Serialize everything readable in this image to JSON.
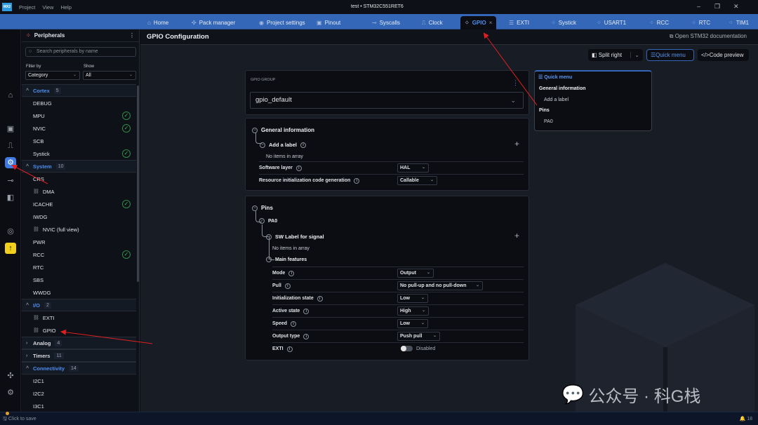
{
  "titlebar": {
    "logo": "MX2",
    "menus": [
      "Project",
      "View",
      "Help"
    ],
    "title": "test  •  STM32C551RET6"
  },
  "tabs": [
    {
      "label": "Home",
      "icon": "home-icon"
    },
    {
      "label": "Pack manager",
      "icon": "puzzle-icon"
    },
    {
      "label": "Project settings",
      "icon": "settings-icon"
    },
    {
      "label": "Pinout",
      "icon": "chip-icon"
    },
    {
      "label": "Syscalls",
      "icon": "syscalls-icon"
    },
    {
      "label": "Clock",
      "icon": "clock-signal-icon"
    },
    {
      "label": "GPIO",
      "icon": "peripheral-icon",
      "active": true
    },
    {
      "label": "EXTI",
      "icon": "sliders-icon"
    },
    {
      "label": "Systick",
      "icon": "peripheral-icon"
    },
    {
      "label": "USART1",
      "icon": "peripheral-icon"
    },
    {
      "label": "RCC",
      "icon": "peripheral-icon"
    },
    {
      "label": "RTC",
      "icon": "peripheral-icon"
    },
    {
      "label": "TIM1",
      "icon": "peripheral-icon"
    }
  ],
  "sidebar": {
    "title": "Peripherals",
    "search_placeholder": "Search peripherals by name",
    "filter_label": "Filter by",
    "filter_value": "Category",
    "show_label": "Show",
    "show_value": "All",
    "groups": [
      {
        "label": "Cortex",
        "count": "5",
        "open": true,
        "items": [
          {
            "label": "DEBUG"
          },
          {
            "label": "MPU",
            "ok": true
          },
          {
            "label": "NVIC",
            "ok": true
          },
          {
            "label": "SCB"
          },
          {
            "label": "Systick",
            "ok": true
          }
        ]
      },
      {
        "label": "System",
        "count": "10",
        "open": true,
        "items": [
          {
            "label": "CRS"
          },
          {
            "label": "DMA",
            "link": true
          },
          {
            "label": "ICACHE",
            "ok": true
          },
          {
            "label": "IWDG"
          },
          {
            "label": "NVIC (full view)",
            "link": true
          },
          {
            "label": "PWR"
          },
          {
            "label": "RCC",
            "ok": true
          },
          {
            "label": "RTC"
          },
          {
            "label": "SBS"
          },
          {
            "label": "WWDG"
          }
        ]
      },
      {
        "label": "I/O",
        "count": "2",
        "open": true,
        "items": [
          {
            "label": "EXTI",
            "link": true
          },
          {
            "label": "GPIO",
            "link": true
          }
        ]
      },
      {
        "label": "Analog",
        "count": "4",
        "open": false,
        "items": []
      },
      {
        "label": "Timers",
        "count": "11",
        "open": false,
        "items": []
      },
      {
        "label": "Connectivity",
        "count": "14",
        "open": true,
        "items": [
          {
            "label": "I2C1"
          },
          {
            "label": "I2C2"
          },
          {
            "label": "I3C1"
          }
        ]
      }
    ]
  },
  "main": {
    "title": "GPIO Configuration",
    "doc_link": "Open STM32 documentation",
    "split_right": "Split right",
    "quick_menu": "Quick menu",
    "code_preview": "Code preview",
    "group_label": "GPIO GROUP",
    "group_value": "gpio_default",
    "general": {
      "title": "General information",
      "add_label": "Add a label",
      "empty": "No items in array",
      "rows": [
        {
          "label": "Software layer",
          "value": "HAL"
        },
        {
          "label": "Resource initialization code generation",
          "value": "Callable"
        }
      ]
    },
    "pins": {
      "title": "Pins",
      "pin": "PA0",
      "sw_label": "SW Label for signal",
      "empty": "No items in array",
      "main_features": "Main features",
      "rows": [
        {
          "label": "Mode",
          "value": "Output"
        },
        {
          "label": "Pull",
          "value": "No pull-up and no pull-down"
        },
        {
          "label": "Initialization state",
          "value": "Low"
        },
        {
          "label": "Active state",
          "value": "High"
        },
        {
          "label": "Speed",
          "value": "Low"
        },
        {
          "label": "Output type",
          "value": "Push pull"
        }
      ],
      "exti_label": "EXTI",
      "exti_state": "Disabled",
      "exti_enabled": false
    }
  },
  "quick_menu": {
    "title": "Quick menu",
    "items": [
      "General information",
      "Add a label",
      "Pins",
      "PA0"
    ]
  },
  "status": {
    "save": "Click to save",
    "notifications": "18"
  },
  "watermark": "公众号 · 科G栈",
  "colors": {
    "accent": "#3567b8",
    "active_text": "#4d8ef0",
    "ok": "#3bb35a",
    "annotation": "#e02020"
  }
}
